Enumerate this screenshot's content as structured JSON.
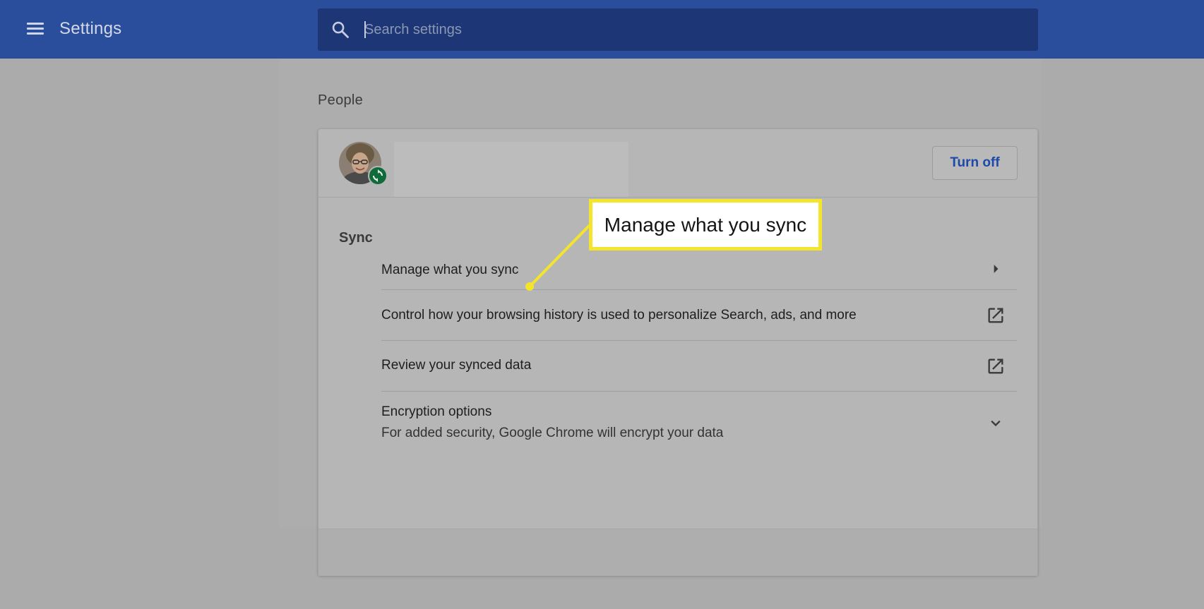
{
  "header": {
    "title": "Settings",
    "menu_icon": "hamburger-menu-icon",
    "search_icon": "search-icon",
    "search_placeholder": "Search settings"
  },
  "people": {
    "heading": "People",
    "avatar_icon": "profile-photo",
    "sync_badge_icon": "sync-icon",
    "turn_off_label": "Turn off",
    "sync_section_label": "Sync",
    "rows": [
      {
        "label": "Manage what you sync",
        "icon": "chevron-right-icon"
      },
      {
        "label": "Control how your browsing history is used to personalize Search, ads, and more",
        "icon": "open-in-new-icon"
      },
      {
        "label": "Review your synced data",
        "icon": "open-in-new-icon"
      },
      {
        "label": "Encryption options",
        "sublabel": "For added security, Google Chrome will encrypt your data",
        "icon": "chevron-down-icon"
      }
    ]
  },
  "annotation": {
    "callout_text": "Manage what you sync",
    "highlight_color": "#f3e52b"
  },
  "colors": {
    "topbar": "#2a4d9c",
    "search_box": "#1d3675",
    "link_blue": "#1d4aa8",
    "sync_badge": "#0f6b3a"
  }
}
